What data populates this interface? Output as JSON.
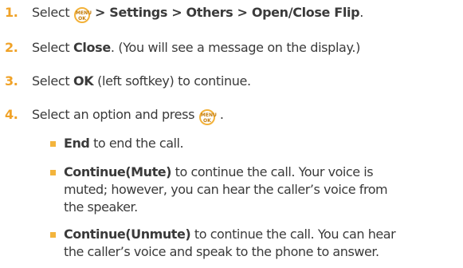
{
  "steps": [
    {
      "number": "1.",
      "prefix": "Select",
      "icon": "menu-ok-icon",
      "path": "> Settings > Others > Open/Close Flip",
      "suffix": "."
    },
    {
      "number": "2.",
      "prefix": "Select",
      "bold": "Close",
      "suffix": ". (You will see a message on the display.)"
    },
    {
      "number": "3.",
      "prefix": "Select",
      "bold": "OK",
      "suffix": "(left softkey) to continue."
    },
    {
      "number": "4.",
      "prefix": "Select an option and press",
      "icon": "menu-ok-icon",
      "suffix": "."
    }
  ],
  "icon_text": {
    "top": "MENU",
    "bottom": "OK"
  },
  "options": [
    {
      "bold": "End",
      "lines": [
        "to end the call."
      ]
    },
    {
      "bold": "Continue(Mute)",
      "lines": [
        "to continue the call. Your voice is",
        "muted; however, you can hear the caller’s voice from",
        "the speaker."
      ]
    },
    {
      "bold": "Continue(Unmute)",
      "lines": [
        "to continue the call. You can hear",
        "the caller’s voice and speak to the phone to answer."
      ]
    }
  ],
  "colors": {
    "accent": "#f0a227",
    "text": "#3a3a3a"
  }
}
